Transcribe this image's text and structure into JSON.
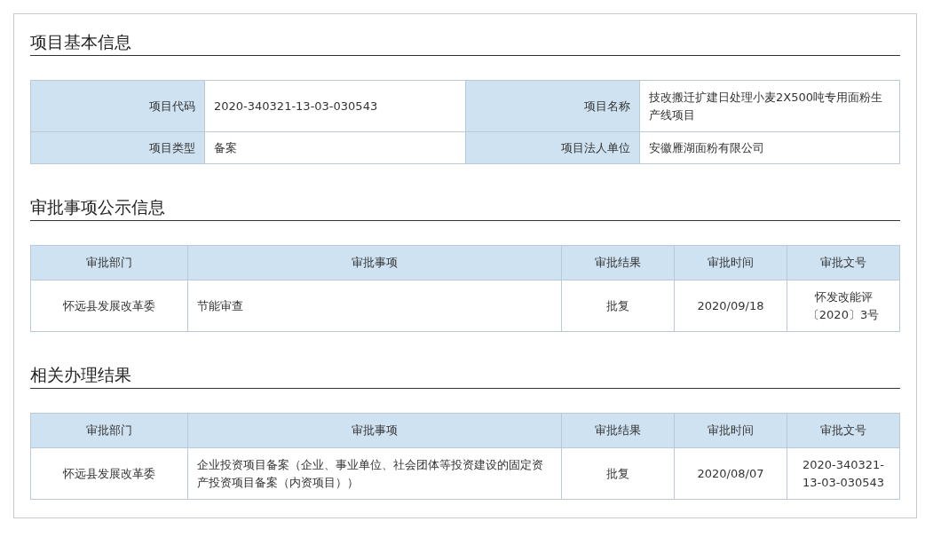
{
  "basic_info": {
    "title": "项目基本信息",
    "rows": [
      [
        {
          "label": "项目代码",
          "value": "2020-340321-13-03-030543"
        },
        {
          "label": "项目名称",
          "value": "技改搬迁扩建日处理小麦2X500吨专用面粉生产线项目"
        }
      ],
      [
        {
          "label": "项目类型",
          "value": "备案"
        },
        {
          "label": "项目法人单位",
          "value": "安徽雁湖面粉有限公司"
        }
      ]
    ]
  },
  "approval_notice": {
    "title": "审批事项公示信息",
    "columns": [
      "审批部门",
      "审批事项",
      "审批结果",
      "审批时间",
      "审批文号"
    ],
    "rows": [
      [
        "怀远县发展改革委",
        "节能审查",
        "批复",
        "2020/09/18",
        "怀发改能评〔2020〕3号"
      ]
    ]
  },
  "related_results": {
    "title": "相关办理结果",
    "columns": [
      "审批部门",
      "审批事项",
      "审批结果",
      "审批时间",
      "审批文号"
    ],
    "rows": [
      [
        "怀远县发展改革委",
        "企业投资项目备案（企业、事业单位、社会团体等投资建设的固定资产投资项目备案（内资项目））",
        "批复",
        "2020/08/07",
        "2020-340321-13-03-030543"
      ]
    ]
  }
}
